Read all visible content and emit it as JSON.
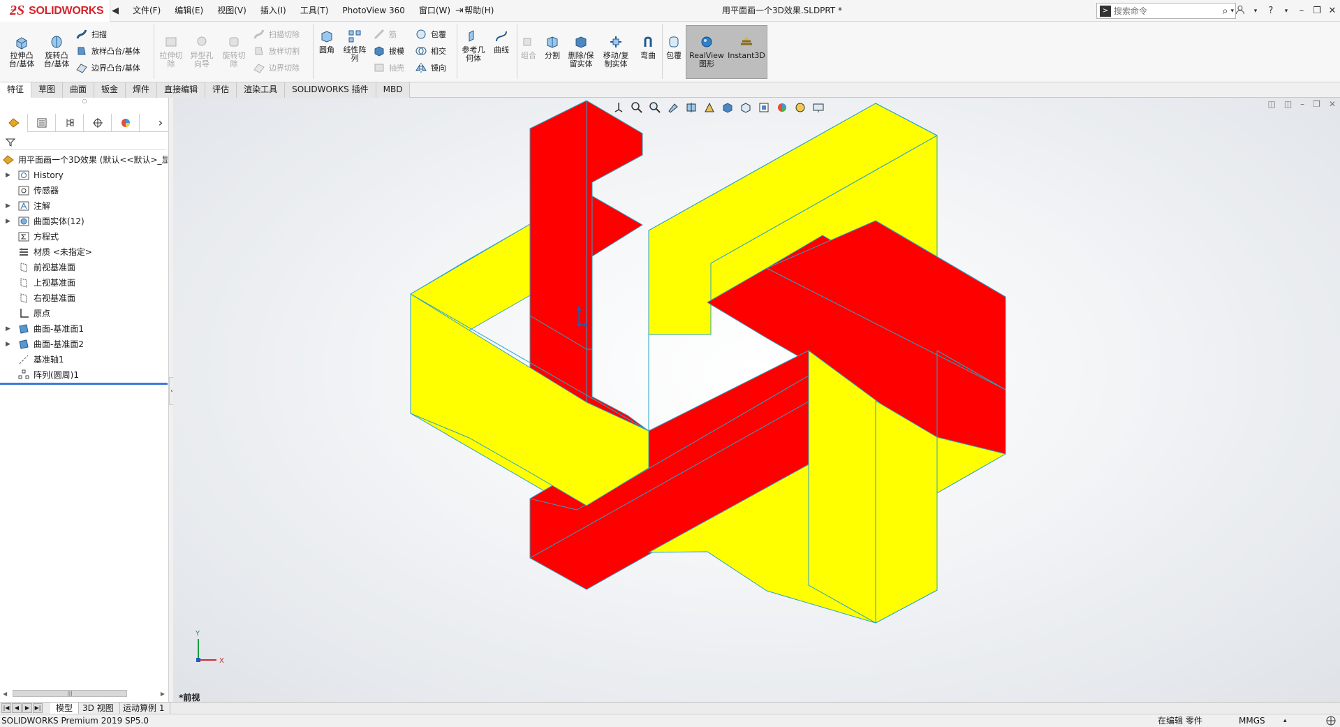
{
  "titlebar": {
    "app_name": "SOLIDWORKS",
    "menus": [
      "文件(F)",
      "编辑(E)",
      "视图(V)",
      "插入(I)",
      "工具(T)",
      "PhotoView 360",
      "窗口(W)",
      "帮助(H)"
    ],
    "document_title": "用平面画一个3D效果.SLDPRT *",
    "search_placeholder": "搜索命令"
  },
  "commands": {
    "extrude_boss": "拉伸凸台/基体",
    "revolve_boss": "旋转凸台/基体",
    "sweep": "扫描",
    "loft_boss": "放样凸台/基体",
    "boundary_boss": "边界凸台/基体",
    "extrude_cut": "拉伸切除",
    "hole_wizard": "异型孔向导",
    "revolve_cut": "旋转切除",
    "sweep_cut": "扫描切除",
    "loft_cut": "放样切割",
    "boundary_cut": "边界切除",
    "fillet": "圆角",
    "linear_pattern": "线性阵列",
    "rib": "筋",
    "draft": "拔模",
    "shell": "抽壳",
    "wrap": "包覆",
    "intersect": "相交",
    "mirror": "镜向",
    "reference_geometry": "参考几何体",
    "curves": "曲线",
    "combine": "组合",
    "split": "分割",
    "delete_keep_body": "删除/保留实体",
    "move_copy_body": "移动/复制实体",
    "flex": "弯曲",
    "wrap2": "包覆",
    "realview": "RealView图形",
    "instant3d": "Instant3D"
  },
  "tabs": [
    "特征",
    "草图",
    "曲面",
    "钣金",
    "焊件",
    "直接编辑",
    "评估",
    "渲染工具",
    "SOLIDWORKS 插件",
    "MBD"
  ],
  "tree": {
    "root": "用平面画一个3D效果 (默认<<默认>_显",
    "items": [
      "History",
      "传感器",
      "注解",
      "曲面实体(12)",
      "方程式",
      "材质 <未指定>",
      "前视基准面",
      "上视基准面",
      "右视基准面",
      "原点",
      "曲面-基准面1",
      "曲面-基准面2",
      "基准轴1",
      "阵列(圆周)1"
    ]
  },
  "viewport": {
    "view_label": "*前视",
    "triad_y": "Y",
    "triad_x": "X"
  },
  "bottom_tabs": [
    "模型",
    "3D 视图",
    "运动算例 1"
  ],
  "status": {
    "product": "SOLIDWORKS Premium 2019 SP5.0",
    "mode": "在编辑 零件",
    "units": "MMGS"
  },
  "colors": {
    "red": "#ff0000",
    "yellow": "#ffff00",
    "edge": "#2aa3c8",
    "brand": "#d3242a"
  }
}
